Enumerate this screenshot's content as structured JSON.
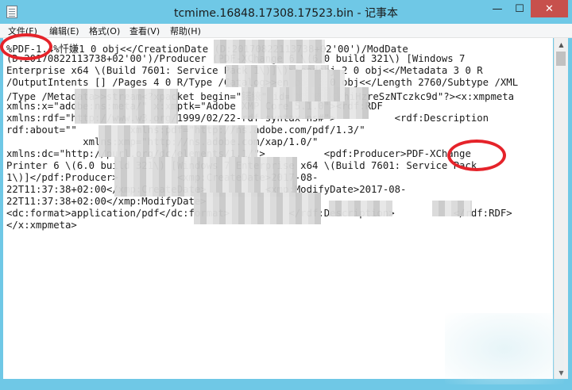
{
  "window": {
    "title": "tcmime.16848.17308.17523.bin - 记事本",
    "minimize_glyph": "—",
    "maximize_glyph": "☐",
    "close_glyph": "✕"
  },
  "menu": {
    "items": [
      "文件(F)",
      "编辑(E)",
      "格式(O)",
      "查看(V)",
      "帮助(H)"
    ]
  },
  "editor": {
    "lines": [
      "%PDF-1.4%忏嫌1 0 obj<</CreationDate (D:20170822113738+02'00')/ModDate",
      "(D:20170822113738+02'00')/Producer (PDF-XChange 6 \\(6.0 build 321\\) [Windows 7",
      "Enterprise x64 \\(Build 7601: Service Pack 1\\)]\\)>>endobj 2 0 obj<</Metadata 3 0 R",
      "/OutputIntents [] /Pages 4 0 R/Type /Catalog>>endobj 3 0 obj<</Length 2760/Subtype /XML",
      "/Type /Metadata>>stream<?xpacket begin=\"锘縗\" id=\"W5M0MpCehiHzreSzNTczkc9d\"?><x:xmpmeta",
      "xmlns:x=\"adobe:ns:meta/\" x:xmptk=\"Adobe XMP Core 5.1.0\"><rdf:RDF",
      "xmlns:rdf=\"http://www.w3.org/1999/02/22-rdf-syntax-ns#\">          <rdf:Description",
      "rdf:about=\"\"         xmlns:pdf=\"http://ns.adobe.com/pdf/1.3/\"",
      "             xmlns:xmp=\"http://ns.adobe.com/xap/1.0/\"",
      "xmlns:dc=\"http://purl.org/dc/elements/1.1/\">          <pdf:Producer>PDF-XChange",
      "Printer 6 \\(6.0 build 321\\) [Windows 7 Enterprise x64 \\(Build 7601: Service Pack",
      "1\\)]</pdf:Producer>          <xmp:CreateDate>2017-08-",
      "22T11:37:38+02:00</xmp:CreateDate>          <xmp:ModifyDate>2017-08-",
      "22T11:37:38+02:00</xmp:ModifyDate>",
      "<dc:format>application/pdf</dc:format>          </rdf:Description>          </rdf:RDF>",
      "</x:xmpmeta>"
    ]
  }
}
